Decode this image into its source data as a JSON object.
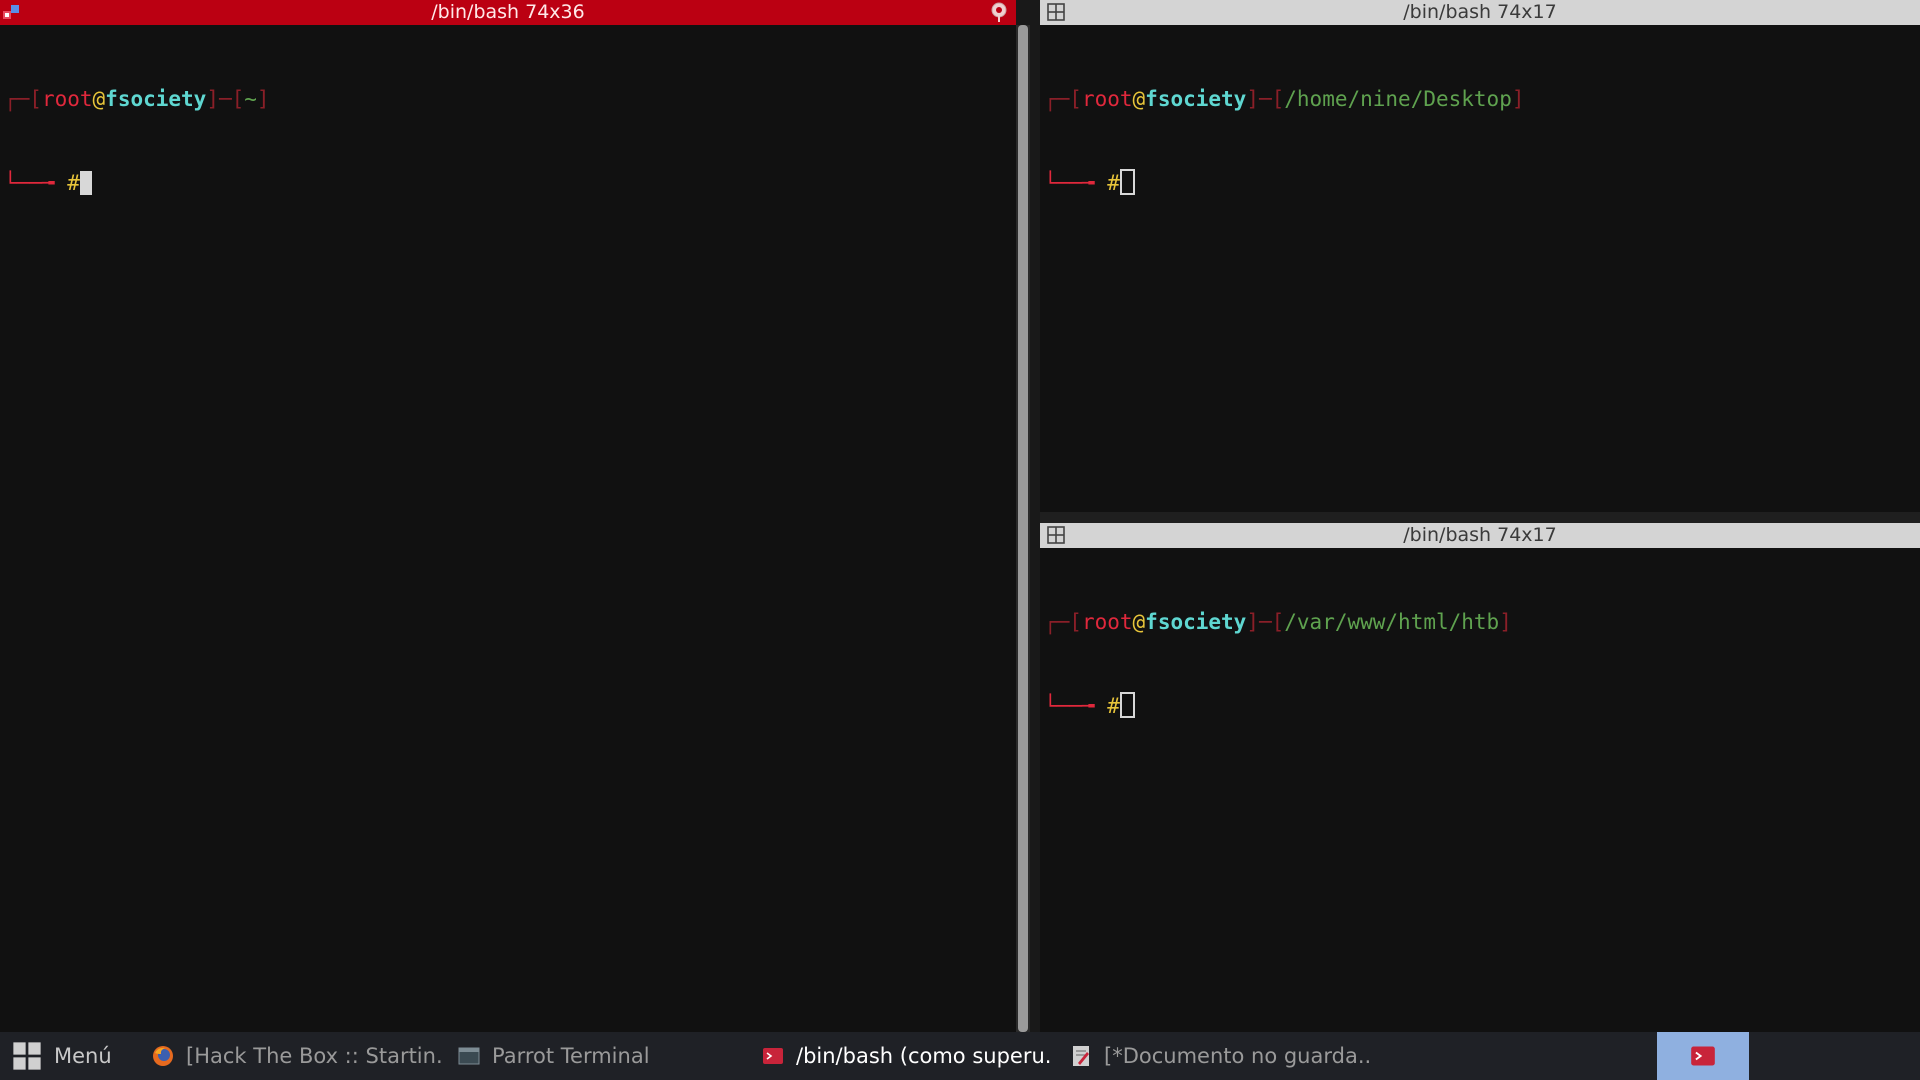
{
  "window": {
    "left_pane": {
      "title": "/bin/bash 74x36",
      "prompt": {
        "open": "┌─[",
        "user": "root",
        "at": "@",
        "host": "fsociety",
        "sep": "]─[",
        "path": "~",
        "close": "]",
        "arrow": "└──╼ ",
        "symbol": "#"
      }
    },
    "top_right_pane": {
      "title": "/bin/bash 74x17",
      "prompt": {
        "open": "┌─[",
        "user": "root",
        "at": "@",
        "host": "fsociety",
        "sep": "]─[",
        "path": "/home/nine/Desktop",
        "close": "]",
        "arrow": "└──╼ ",
        "symbol": "#"
      }
    },
    "bottom_right_pane": {
      "title": "/bin/bash 74x17",
      "prompt": {
        "open": "┌─[",
        "user": "root",
        "at": "@",
        "host": "fsociety",
        "sep": "]─[",
        "path": "/var/www/html/htb",
        "close": "]",
        "arrow": "└──╼ ",
        "symbol": "#"
      }
    }
  },
  "taskbar": {
    "menu_label": "Menú",
    "items": [
      {
        "label": "[Hack The Box :: Startin...",
        "icon": "firefox-icon"
      },
      {
        "label": "Parrot Terminal",
        "icon": "terminal-icon"
      },
      {
        "label": "/bin/bash (como superu...",
        "icon": "terminal-root-icon"
      },
      {
        "label": "[*Documento no guarda...",
        "icon": "text-editor-icon"
      }
    ]
  },
  "colors": {
    "active_titlebar": "#bb0012",
    "inactive_titlebar": "#d4d4d4",
    "prompt_bracket": "#e0283c",
    "prompt_user": "#e0283c",
    "prompt_host": "#5fd7d1",
    "prompt_path": "#5fa24f",
    "prompt_symbol": "#e8c53a",
    "taskbar_bg": "#1f2126",
    "taskbar_active": "#8fb0e0"
  }
}
